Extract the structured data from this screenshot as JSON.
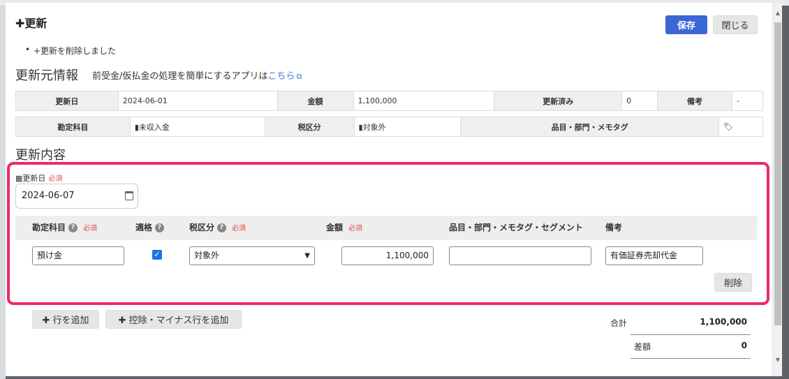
{
  "modal": {
    "title": "✚更新",
    "save_label": "保存",
    "close_label": "閉じる",
    "message": "+更新を削除しました"
  },
  "source_info": {
    "heading": "更新元情報",
    "note": "前受金/仮払金の処理を簡単にするアプリは",
    "link_text": "こちら",
    "row1": {
      "date_label": "更新日",
      "date_value": "2024-06-01",
      "amount_label": "金額",
      "amount_value": "1,100,000",
      "updated_label": "更新済み",
      "updated_value": "0",
      "memo_label": "備考",
      "memo_value": "-"
    },
    "row2": {
      "account_label": "勘定科目",
      "account_value": "▮未収入金",
      "tax_label": "税区分",
      "tax_value": "▮対象外",
      "tags_label": "品目・部門・メモタグ"
    }
  },
  "update_content": {
    "heading": "更新内容",
    "date_label": "更新日",
    "required": "必須",
    "date_value": "2024-06-07",
    "columns": {
      "account": "勘定科目",
      "fit": "適格",
      "tax": "税区分",
      "amount": "金額",
      "tags": "品目・部門・メモタグ・セグメント",
      "memo": "備考"
    },
    "row": {
      "account": "預け金",
      "fit_checked": true,
      "tax": "対象外",
      "amount": "1,100,000",
      "tags": "",
      "memo": "有価証券売却代金"
    },
    "delete_label": "削除"
  },
  "actions": {
    "add_row": "行を追加",
    "add_minus_row": "控除・マイナス行を追加"
  },
  "totals": {
    "total_label": "合計",
    "total_value": "1,100,000",
    "diff_label": "差額",
    "diff_value": "0"
  },
  "colors": {
    "accent": "#3a66d6",
    "highlight": "#ee2a68",
    "link": "#3a7bd5",
    "required": "#e0484a"
  }
}
